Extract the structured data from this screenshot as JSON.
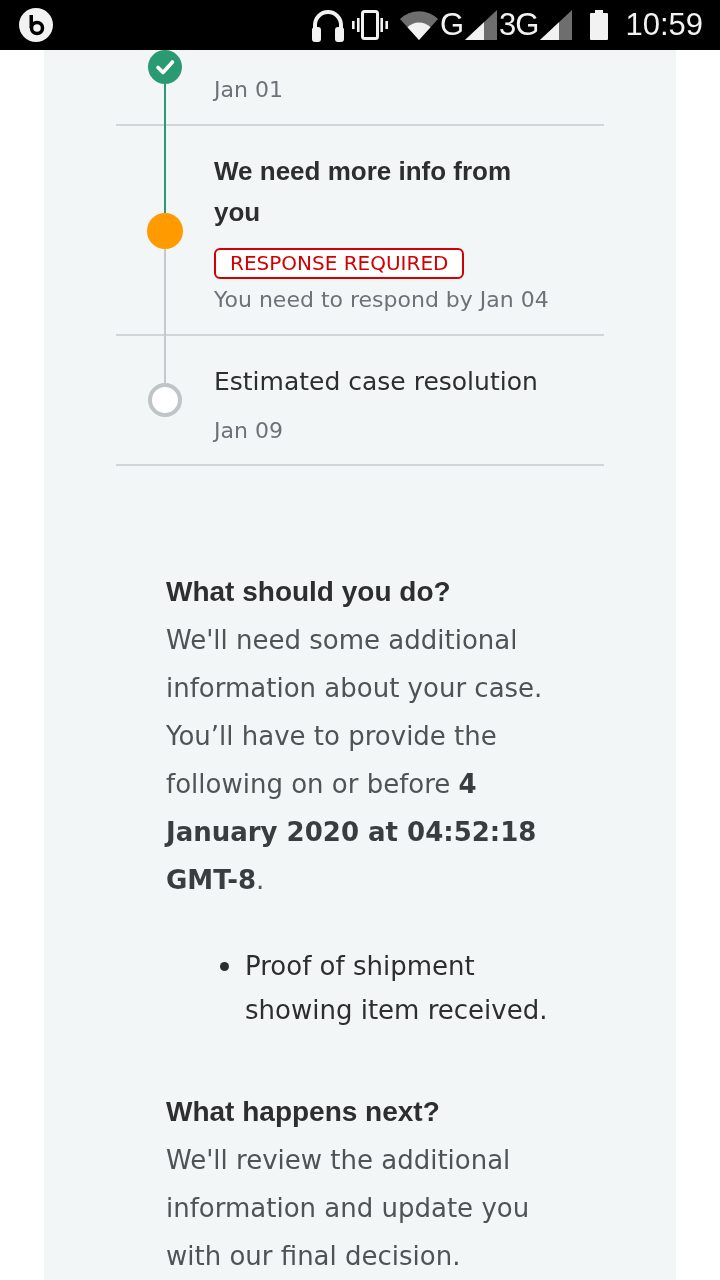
{
  "status_bar": {
    "networks": [
      {
        "label": "G"
      },
      {
        "label": "3G"
      }
    ],
    "time": "10:59"
  },
  "timeline": {
    "steps": [
      {
        "kind": "done",
        "detail": "Jan 01"
      },
      {
        "kind": "current",
        "title": "We need more info from you",
        "badge": "RESPONSE REQUIRED",
        "detail": "You need to respond by Jan 04"
      },
      {
        "kind": "pending",
        "title": "Estimated case resolution",
        "detail": "Jan 09"
      }
    ]
  },
  "sections": [
    {
      "heading": "What should you do?",
      "body": "We'll need some additional information about your case. You’ll have to provide the following on or before **4 January 2020 at 04:52:18 GMT-8**.",
      "bullets": [
        "Proof of shipment showing item received."
      ]
    },
    {
      "heading": "What happens next?",
      "body": "We'll review the additional information and update you with our final decision."
    }
  ]
}
